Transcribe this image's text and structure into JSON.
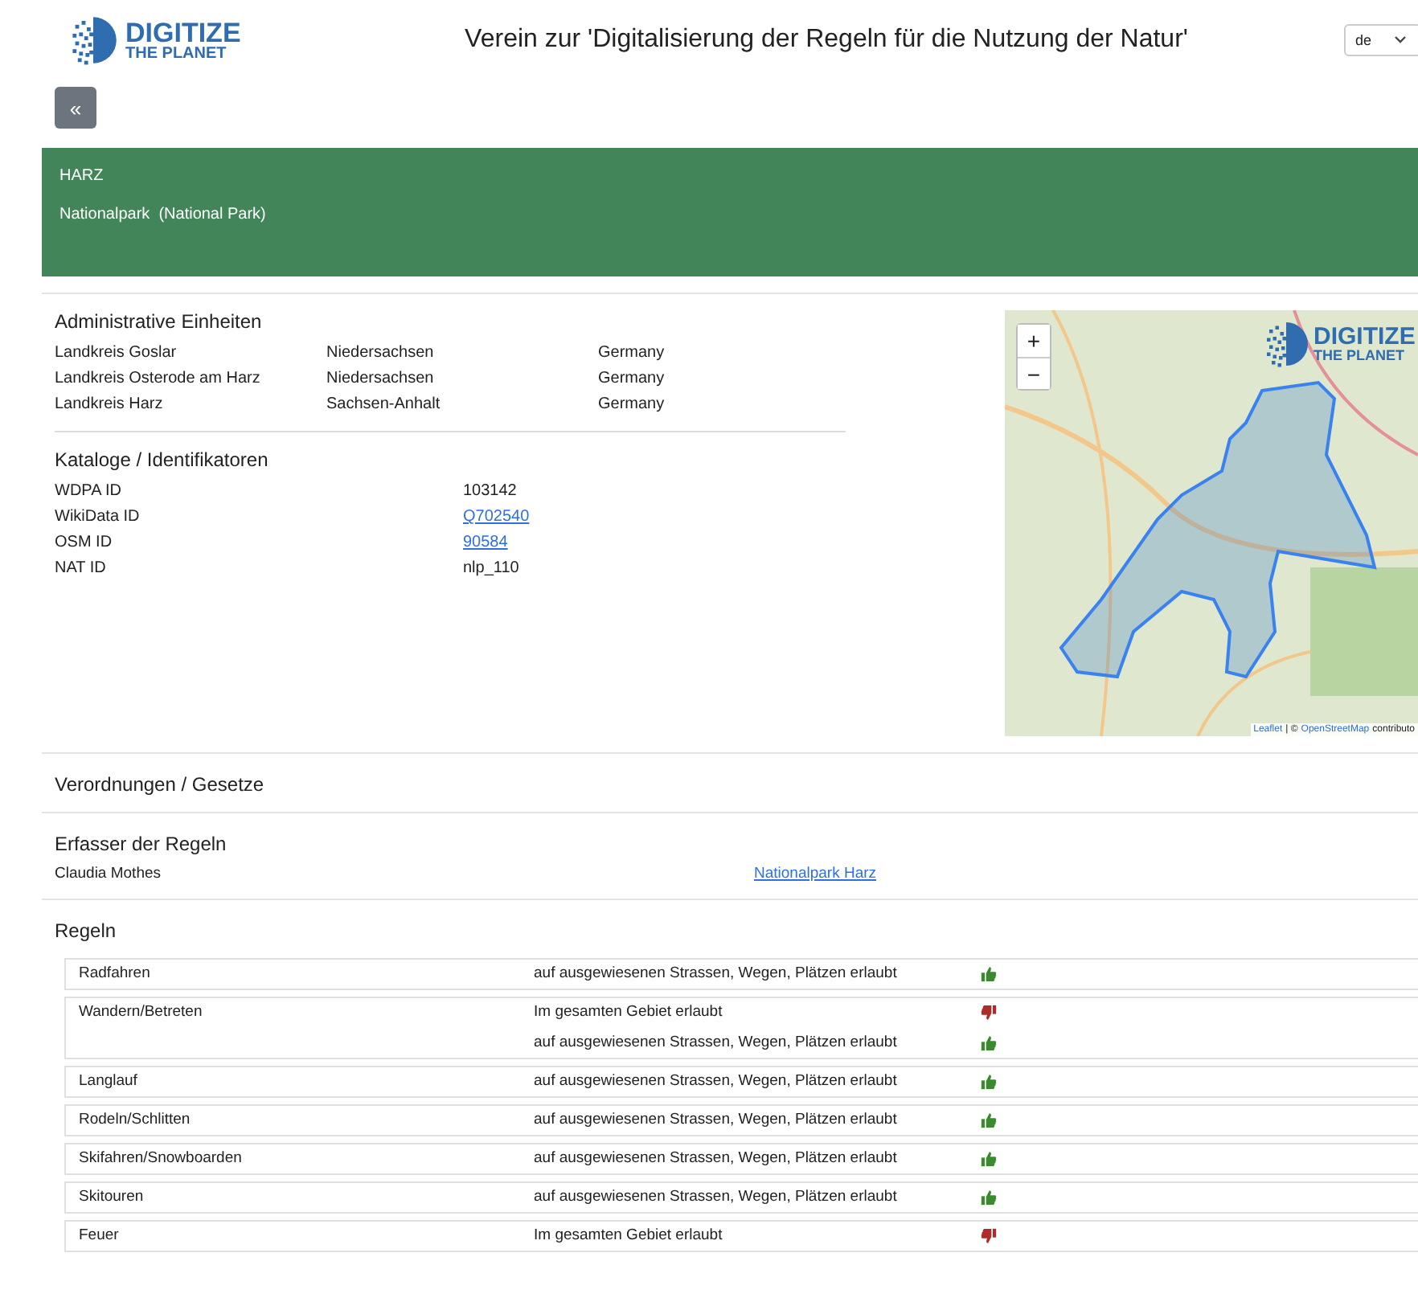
{
  "header": {
    "logo_line_1": "DIGITIZE",
    "logo_line_2": "THE PLANET",
    "title": "Verein zur 'Digitalisierung der Regeln für die Nutzung der Natur'",
    "language": "de"
  },
  "back_button": "«",
  "banner": {
    "name": "HARZ",
    "category": "Nationalpark  (National Park)"
  },
  "admin_units": {
    "heading": "Administrative Einheiten",
    "rows": [
      {
        "district": "Landkreis Goslar",
        "state": "Niedersachsen",
        "country": "Germany"
      },
      {
        "district": "Landkreis Osterode am Harz",
        "state": "Niedersachsen",
        "country": "Germany"
      },
      {
        "district": "Landkreis Harz",
        "state": "Sachsen-Anhalt",
        "country": "Germany"
      }
    ]
  },
  "catalogs": {
    "heading": "Kataloge / Identifikatoren",
    "rows": [
      {
        "label": "WDPA ID",
        "value": "103142",
        "kind": "text"
      },
      {
        "label": "WikiData ID",
        "value": "Q702540",
        "kind": "link"
      },
      {
        "label": "OSM ID",
        "value": "90584",
        "kind": "link"
      },
      {
        "label": "NAT ID",
        "value": "nlp_110",
        "kind": "text"
      }
    ]
  },
  "map": {
    "zoom_in": "+",
    "zoom_out": "−",
    "logo_line_1": "DIGITIZE",
    "logo_line_2": "THE PLANET",
    "attribution_leaflet": "Leaflet",
    "attribution_separator": "| ©",
    "attribution_osm": "OpenStreetMap",
    "attribution_rest": "contributo"
  },
  "regulations": {
    "heading": "Verordnungen / Gesetze"
  },
  "authors": {
    "heading": "Erfasser der Regeln",
    "name": "Claudia Mothes",
    "organization": "Nationalpark Harz"
  },
  "rules": {
    "heading": "Regeln",
    "rows": [
      {
        "activity": "Radfahren",
        "entries": [
          {
            "text": "auf ausgewiesenen Strassen, Wegen, Plätzen erlaubt",
            "allowed": true
          }
        ]
      },
      {
        "activity": "Wandern/Betreten",
        "entries": [
          {
            "text": "Im gesamten Gebiet erlaubt",
            "allowed": false
          },
          {
            "text": "auf ausgewiesenen Strassen, Wegen, Plätzen erlaubt",
            "allowed": true
          }
        ]
      },
      {
        "activity": "Langlauf",
        "entries": [
          {
            "text": "auf ausgewiesenen Strassen, Wegen, Plätzen erlaubt",
            "allowed": true
          }
        ]
      },
      {
        "activity": "Rodeln/Schlitten",
        "entries": [
          {
            "text": "auf ausgewiesenen Strassen, Wegen, Plätzen erlaubt",
            "allowed": true
          }
        ]
      },
      {
        "activity": "Skifahren/Snowboarden",
        "entries": [
          {
            "text": "auf ausgewiesenen Strassen, Wegen, Plätzen erlaubt",
            "allowed": true
          }
        ]
      },
      {
        "activity": "Skitouren",
        "entries": [
          {
            "text": "auf ausgewiesenen Strassen, Wegen, Plätzen erlaubt",
            "allowed": true
          }
        ]
      },
      {
        "activity": "Feuer",
        "entries": [
          {
            "text": "Im gesamten Gebiet erlaubt",
            "allowed": false
          }
        ]
      }
    ]
  }
}
